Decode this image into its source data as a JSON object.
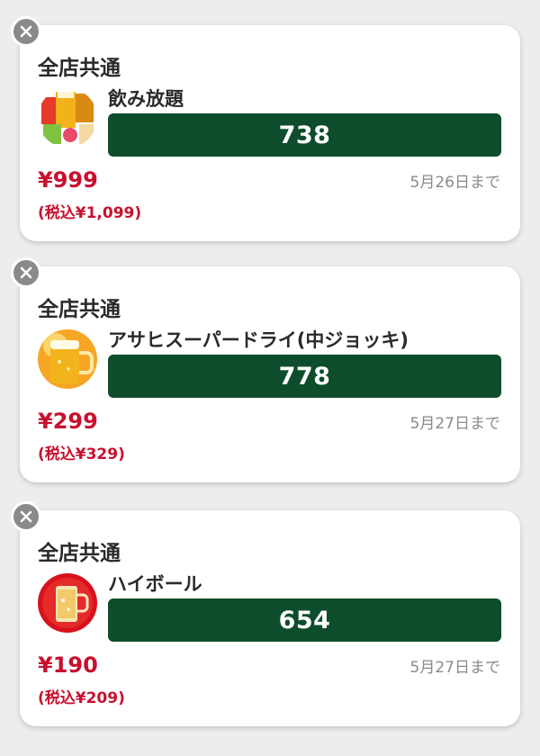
{
  "coupons": [
    {
      "scope": "全店共通",
      "product": "飲み放題",
      "code": "738",
      "price": "¥999",
      "price_tax_included": "(税込¥1,099)",
      "deadline": "5月26日まで",
      "thumbnail_icon": "drinks-assortment-icon"
    },
    {
      "scope": "全店共通",
      "product": "アサヒスーパードライ(中ジョッキ)",
      "code": "778",
      "price": "¥299",
      "price_tax_included": "(税込¥329)",
      "deadline": "5月27日まで",
      "thumbnail_icon": "beer-mug-icon"
    },
    {
      "scope": "全店共通",
      "product": "ハイボール",
      "code": "654",
      "price": "¥190",
      "price_tax_included": "(税込¥209)",
      "deadline": "5月27日まで",
      "thumbnail_icon": "highball-glass-icon"
    }
  ],
  "colors": {
    "code_bar": "#0e4d2b",
    "price_red": "#c8102e",
    "close_button": "#8a8a8a"
  }
}
